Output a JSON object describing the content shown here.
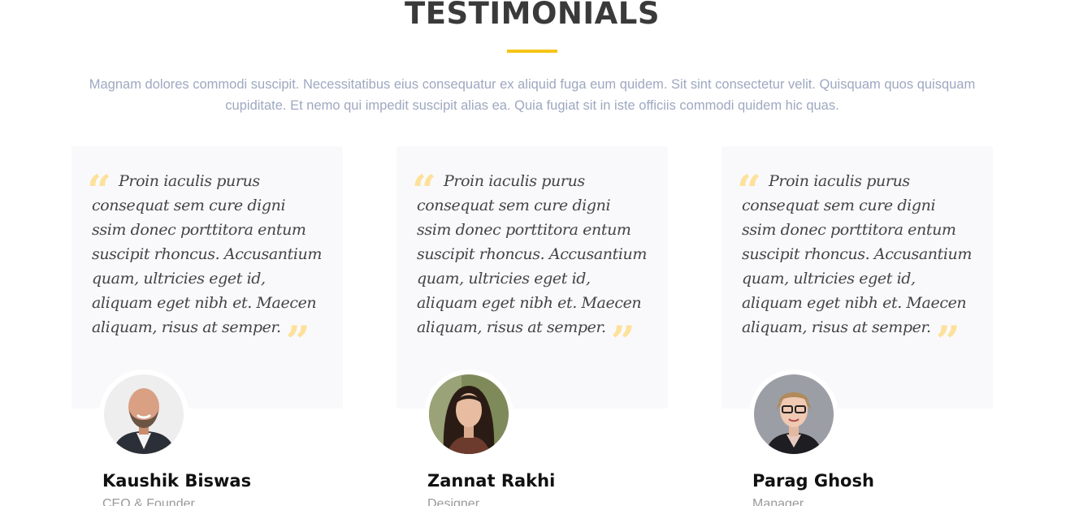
{
  "section": {
    "title": "TESTIMONIALS",
    "intro": "Magnam dolores commodi suscipit. Necessitatibus eius consequatur ex aliquid fuga eum quidem. Sit sint consectetur velit. Quisquam quos quisquam cupiditate. Et nemo qui impedit suscipit alias ea. Quia fugiat sit in iste officiis commodi quidem hic quas.",
    "accent_color": "#f5c518",
    "quote_mark_color": "#fde19a"
  },
  "testimonials": [
    {
      "quote": "Proin iaculis purus consequat sem cure digni ssim donec porttitora entum suscipit rhoncus. Accusantium quam, ultricies eget id, aliquam eget nibh et. Maecen aliquam, risus at semper.",
      "name": "Kaushik Biswas",
      "role": "CEO & Founder"
    },
    {
      "quote": "Proin iaculis purus consequat sem cure digni ssim donec porttitora entum suscipit rhoncus. Accusantium quam, ultricies eget id, aliquam eget nibh et. Maecen aliquam, risus at semper.",
      "name": "Zannat Rakhi",
      "role": "Designer"
    },
    {
      "quote": "Proin iaculis purus consequat sem cure digni ssim donec porttitora entum suscipit rhoncus. Accusantium quam, ultricies eget id, aliquam eget nibh et. Maecen aliquam, risus at semper.",
      "name": "Parag Ghosh",
      "role": "Manager"
    }
  ],
  "icons": {
    "open_quote": "open-quote-icon",
    "close_quote": "close-quote-icon"
  }
}
